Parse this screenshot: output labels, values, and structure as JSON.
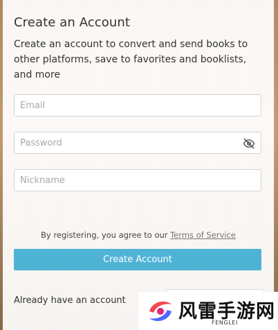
{
  "form": {
    "title": "Create an Account",
    "subtitle": "Create an account to convert and send books to other platforms, save to favorites and booklists, and more",
    "email_placeholder": "Email",
    "password_placeholder": "Password",
    "nickname_placeholder": "Nickname",
    "terms_prefix": "By registering, you agree to our ",
    "terms_link": "Terms of Service",
    "create_button": "Create Account",
    "already_text": "Already have an account"
  },
  "icons": {
    "password_toggle": "eye-slash-icon"
  },
  "colors": {
    "accent": "#4fb3d6"
  },
  "watermark": {
    "text": "风雷手游网",
    "subtext": "FENGLEI"
  }
}
